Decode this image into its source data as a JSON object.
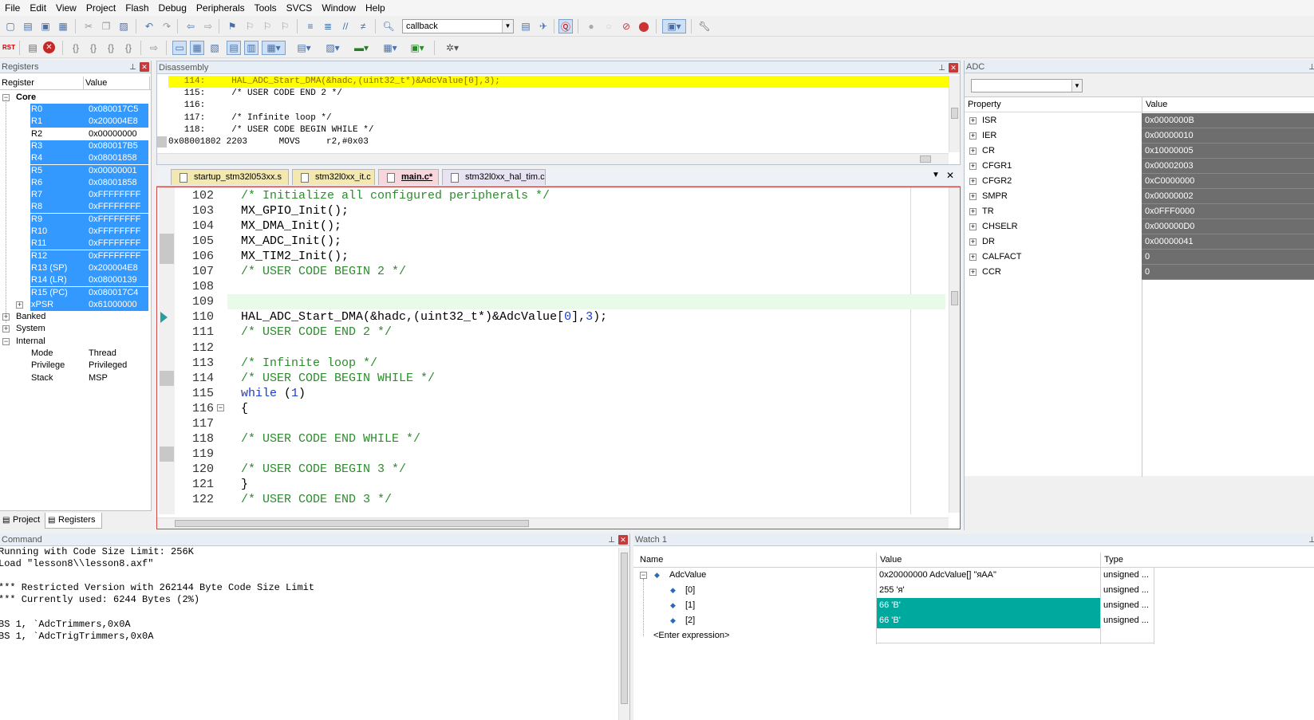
{
  "menu": [
    "File",
    "Edit",
    "View",
    "Project",
    "Flash",
    "Debug",
    "Peripherals",
    "Tools",
    "SVCS",
    "Window",
    "Help"
  ],
  "toolbar": {
    "find_value": "callback",
    "rst_label": "RST"
  },
  "registers_panel": {
    "title": "Registers",
    "col_register": "Register",
    "col_value": "Value",
    "core_label": "Core",
    "core_items": [
      {
        "name": "R0",
        "value": "0x080017C5",
        "hl": true
      },
      {
        "name": "R1",
        "value": "0x200004E8",
        "hl": true
      },
      {
        "name": "R2",
        "value": "0x00000000",
        "hl": false
      },
      {
        "name": "R3",
        "value": "0x080017B5",
        "hl": true
      },
      {
        "name": "R4",
        "value": "0x08001858",
        "hl": true
      },
      {
        "name": "R5",
        "value": "0x00000001",
        "hl": true
      },
      {
        "name": "R6",
        "value": "0x08001858",
        "hl": true
      },
      {
        "name": "R7",
        "value": "0xFFFFFFFF",
        "hl": true
      },
      {
        "name": "R8",
        "value": "0xFFFFFFFF",
        "hl": true
      },
      {
        "name": "R9",
        "value": "0xFFFFFFFF",
        "hl": true
      },
      {
        "name": "R10",
        "value": "0xFFFFFFFF",
        "hl": true
      },
      {
        "name": "R11",
        "value": "0xFFFFFFFF",
        "hl": true
      },
      {
        "name": "R12",
        "value": "0xFFFFFFFF",
        "hl": true
      },
      {
        "name": "R13 (SP)",
        "value": "0x200004E8",
        "hl": true
      },
      {
        "name": "R14 (LR)",
        "value": "0x08000139",
        "hl": true
      },
      {
        "name": "R15 (PC)",
        "value": "0x080017C4",
        "hl": true
      },
      {
        "name": "xPSR",
        "value": "0x61000000",
        "hl": true
      }
    ],
    "groups": [
      "Banked",
      "System",
      "Internal"
    ],
    "internal_items": [
      {
        "name": "Mode",
        "value": "Thread"
      },
      {
        "name": "Privilege",
        "value": "Privileged"
      },
      {
        "name": "Stack",
        "value": "MSP"
      }
    ],
    "tabs": [
      "Project",
      "Registers"
    ]
  },
  "disassembly": {
    "title": "Disassembly",
    "lines": [
      {
        "text": "   114:     HAL_ADC_Start_DMA(&hadc,(uint32_t*)&AdcValue[0],3);",
        "current": true
      },
      {
        "text": "   115:     /* USER CODE END 2 */",
        "current": false
      },
      {
        "text": "   116: ",
        "current": false
      },
      {
        "text": "   117:     /* Infinite loop */",
        "current": false
      },
      {
        "text": "   118:     /* USER CODE BEGIN WHILE */",
        "current": false
      },
      {
        "text": "0x08001802 2203      MOVS     r2,#0x03",
        "current": false
      }
    ]
  },
  "editor": {
    "tabs": [
      {
        "label": "startup_stm32l053xx.s",
        "active": false
      },
      {
        "label": "stm32l0xx_it.c",
        "active": false
      },
      {
        "label": "main.c*",
        "active": true
      },
      {
        "label": "stm32l0xx_hal_tim.c",
        "active": false
      }
    ],
    "lines": [
      {
        "n": "102",
        "code": "/* Initialize all configured peripherals */",
        "type": "cmt"
      },
      {
        "n": "103",
        "code": "MX_GPIO_Init();",
        "type": "plain"
      },
      {
        "n": "104",
        "code": "MX_DMA_Init();",
        "type": "plain"
      },
      {
        "n": "105",
        "code": "MX_ADC_Init();",
        "type": "plain"
      },
      {
        "n": "106",
        "code": "MX_TIM2_Init();",
        "type": "plain"
      },
      {
        "n": "107",
        "code": "/* USER CODE BEGIN 2 */",
        "type": "cmt"
      },
      {
        "n": "108",
        "code": "",
        "type": "plain"
      },
      {
        "n": "109",
        "code": "",
        "type": "plain"
      },
      {
        "n": "110",
        "code_a": "HAL_ADC_Start_DMA(&hadc,(uint32_t*)&AdcValue[",
        "num1": "0",
        "code_b": "],",
        "num2": "3",
        "code_c": ");",
        "type": "call"
      },
      {
        "n": "111",
        "code": "/* USER CODE END 2 */",
        "type": "cmt"
      },
      {
        "n": "112",
        "code": "",
        "type": "plain"
      },
      {
        "n": "113",
        "code": "/* Infinite loop */",
        "type": "cmt"
      },
      {
        "n": "114",
        "code": "/* USER CODE BEGIN WHILE */",
        "type": "cmt"
      },
      {
        "n": "115",
        "kw": "while",
        "rest_a": " (",
        "num": "1",
        "rest_b": ")",
        "type": "while"
      },
      {
        "n": "116",
        "code": "{",
        "type": "plain"
      },
      {
        "n": "117",
        "code": "",
        "type": "plain"
      },
      {
        "n": "118",
        "code": "/* USER CODE END WHILE */",
        "type": "cmt"
      },
      {
        "n": "119",
        "code": "",
        "type": "plain"
      },
      {
        "n": "120",
        "code": "/* USER CODE BEGIN 3 */",
        "type": "cmt"
      },
      {
        "n": "121",
        "code": "}",
        "type": "plain"
      },
      {
        "n": "122",
        "code": "/* USER CODE END 3 */",
        "type": "cmt"
      }
    ]
  },
  "adc_panel": {
    "title": "ADC",
    "col_property": "Property",
    "col_value": "Value",
    "rows": [
      {
        "name": "ISR",
        "value": "0x0000000B"
      },
      {
        "name": "IER",
        "value": "0x00000010"
      },
      {
        "name": "CR",
        "value": "0x10000005"
      },
      {
        "name": "CFGR1",
        "value": "0x00002003"
      },
      {
        "name": "CFGR2",
        "value": "0xC0000000"
      },
      {
        "name": "SMPR",
        "value": "0x00000002"
      },
      {
        "name": "TR",
        "value": "0x0FFF0000"
      },
      {
        "name": "CHSELR",
        "value": "0x000000D0"
      },
      {
        "name": "DR",
        "value": "0x00000041"
      },
      {
        "name": "CALFACT",
        "value": "0"
      },
      {
        "name": "CCR",
        "value": "0"
      }
    ]
  },
  "command": {
    "title": "Command",
    "lines": [
      "Running with Code Size Limit: 256K",
      "Load \"lesson8\\\\lesson8.axf\"",
      "",
      "*** Restricted Version with 262144 Byte Code Size Limit",
      "*** Currently used: 6244 Bytes (2%)",
      "",
      "BS 1, `AdcTrimmers,0x0A",
      "BS 1, `AdcTrigTrimmers,0x0A"
    ]
  },
  "watch": {
    "title": "Watch 1",
    "col_name": "Name",
    "col_value": "Value",
    "col_type": "Type",
    "rows": [
      {
        "name": "AdcValue",
        "value": "0x20000000 AdcValue[] \"яAA\"",
        "type": "unsigned ...",
        "hl": false,
        "indent": 0
      },
      {
        "name": "[0]",
        "value": "255 'я'",
        "type": "unsigned ...",
        "hl": false,
        "indent": 1
      },
      {
        "name": "[1]",
        "value": "66 'B'",
        "type": "unsigned ...",
        "hl": true,
        "indent": 1
      },
      {
        "name": "[2]",
        "value": "66 'B'",
        "type": "unsigned ...",
        "hl": true,
        "indent": 1
      }
    ],
    "enter_expression": "<Enter expression>"
  },
  "colors": {
    "highlight": "#3399ff",
    "current_line": "#ffff00",
    "watch_changed": "#00a99d",
    "adc_value_bg": "#6e6e6e"
  }
}
